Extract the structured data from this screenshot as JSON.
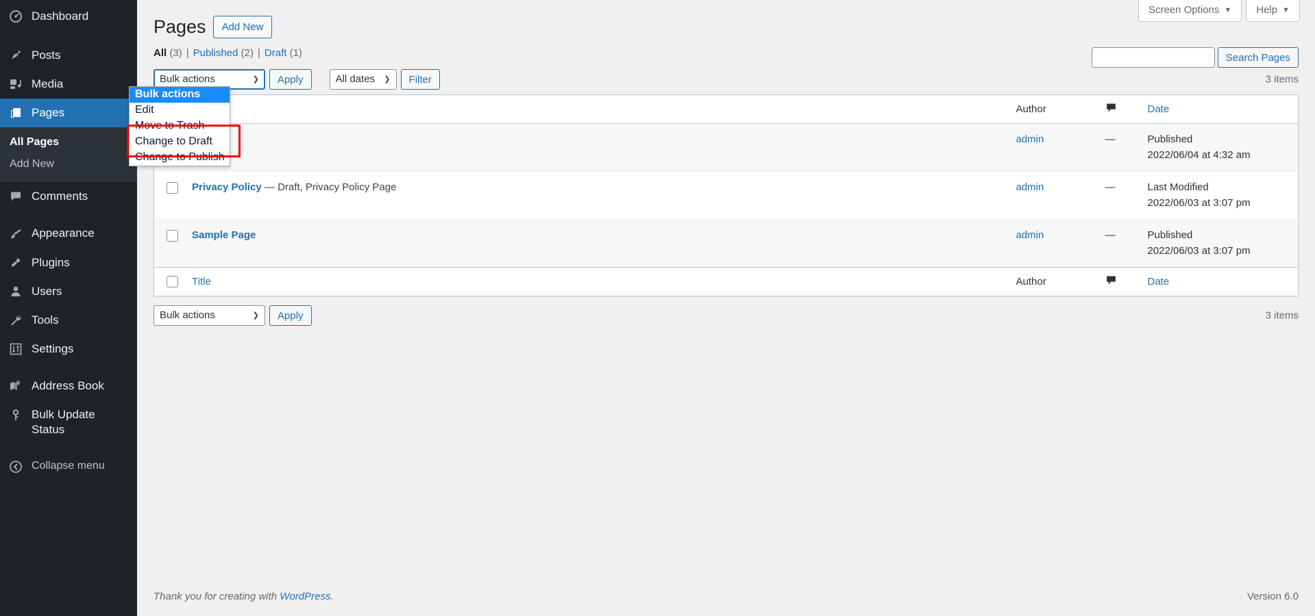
{
  "sidebar": {
    "items": [
      {
        "label": "Dashboard",
        "icon": "dashboard-icon",
        "current": false
      },
      {
        "label": "Posts",
        "icon": "pin-icon",
        "current": false
      },
      {
        "label": "Media",
        "icon": "media-icon",
        "current": false
      },
      {
        "label": "Pages",
        "icon": "pages-icon",
        "current": true
      },
      {
        "label": "Comments",
        "icon": "comment-icon",
        "current": false
      },
      {
        "label": "Appearance",
        "icon": "paintbrush-icon",
        "current": false
      },
      {
        "label": "Plugins",
        "icon": "plug-icon",
        "current": false
      },
      {
        "label": "Users",
        "icon": "user-icon",
        "current": false
      },
      {
        "label": "Tools",
        "icon": "wrench-icon",
        "current": false
      },
      {
        "label": "Settings",
        "icon": "sliders-icon",
        "current": false
      },
      {
        "label": "Address Book",
        "icon": "book-map-icon",
        "current": false
      },
      {
        "label": "Bulk Update Status",
        "icon": "key-icon",
        "current": false
      }
    ],
    "submenu_pages": [
      {
        "label": "All Pages",
        "current": true
      },
      {
        "label": "Add New",
        "current": false
      }
    ],
    "collapse": {
      "label": "Collapse menu",
      "icon": "collapse-arrow-icon"
    }
  },
  "screen_meta": {
    "screen_options_label": "Screen Options",
    "help_label": "Help",
    "caret": "▼"
  },
  "header": {
    "title": "Pages",
    "add_new_label": "Add New"
  },
  "status_links": {
    "all": {
      "label": "All",
      "count": "(3)",
      "current": true
    },
    "published": {
      "label": "Published",
      "count": "(2)",
      "current": false
    },
    "draft": {
      "label": "Draft",
      "count": "(1)",
      "current": false
    },
    "separator": "|"
  },
  "search": {
    "value": "",
    "placeholder": "",
    "button_label": "Search Pages"
  },
  "tablenav_top": {
    "bulk_select_value": "Bulk actions",
    "bulk_options": [
      "Bulk actions",
      "Edit",
      "Move to Trash",
      "Change to Draft",
      "Change to Publish"
    ],
    "apply_label": "Apply",
    "date_select_value": "All dates",
    "date_options": [
      "All dates"
    ],
    "filter_label": "Filter",
    "items_count": "3 items"
  },
  "bulk_dropdown": {
    "open": true,
    "options": [
      {
        "label": "Bulk actions",
        "selected": true
      },
      {
        "label": "Edit",
        "selected": false
      },
      {
        "label": "Move to Trash",
        "selected": false
      },
      {
        "label": "Change to Draft",
        "selected": false
      },
      {
        "label": "Change to Publish",
        "selected": false
      }
    ]
  },
  "annotation": {
    "color": "#f50000",
    "highlights": [
      "Change to Draft",
      "Change to Publish"
    ]
  },
  "table": {
    "columns": {
      "title": "Title",
      "author": "Author",
      "comments": "comment-bubble-icon",
      "date": "Date"
    },
    "rows": [
      {
        "title": "",
        "state": "",
        "author": "admin",
        "comments": "—",
        "date_status": "Published",
        "date_value": "2022/06/04 at 4:32 am",
        "alternate": true
      },
      {
        "title": "Privacy Policy",
        "state": "— Draft, Privacy Policy Page",
        "author": "admin",
        "comments": "—",
        "date_status": "Last Modified",
        "date_value": "2022/06/03 at 3:07 pm",
        "alternate": false
      },
      {
        "title": "Sample Page",
        "state": "",
        "author": "admin",
        "comments": "—",
        "date_status": "Published",
        "date_value": "2022/06/03 at 3:07 pm",
        "alternate": true
      }
    ]
  },
  "tablenav_bottom": {
    "bulk_select_value": "Bulk actions",
    "bulk_options": [
      "Bulk actions",
      "Edit",
      "Move to Trash",
      "Change to Draft",
      "Change to Publish"
    ],
    "apply_label": "Apply",
    "items_count": "3 items"
  },
  "footer": {
    "thanks_prefix": "Thank you for creating with ",
    "wordpress_link": "WordPress",
    "thanks_suffix": ".",
    "version": "Version 6.0"
  }
}
